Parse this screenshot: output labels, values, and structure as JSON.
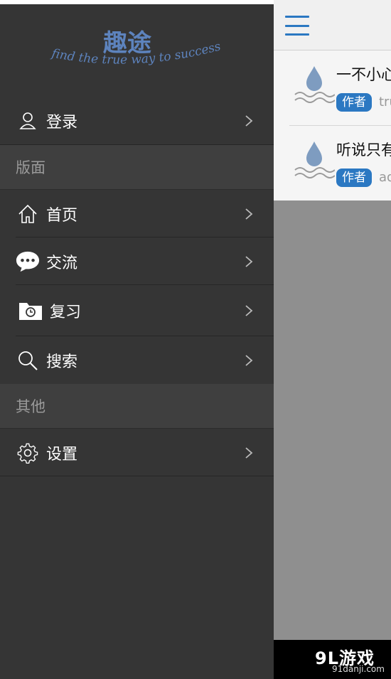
{
  "drawer": {
    "logo": {
      "title": "趣途",
      "slogan": "find the true way to success"
    },
    "login_label": "登录",
    "sections": [
      {
        "title": "版面",
        "items": [
          {
            "label": "首页",
            "icon": "home-icon"
          },
          {
            "label": "交流",
            "icon": "chat-bubble-icon"
          },
          {
            "label": "复习",
            "icon": "folder-history-icon"
          },
          {
            "label": "搜索",
            "icon": "search-icon"
          }
        ]
      },
      {
        "title": "其他",
        "items": [
          {
            "label": "设置",
            "icon": "gear-icon"
          }
        ]
      }
    ]
  },
  "main": {
    "posts": [
      {
        "title": "一不小心",
        "badge": "作者",
        "author": "tru"
      },
      {
        "title": "听说只有",
        "badge": "作者",
        "author": "ad"
      }
    ]
  },
  "watermark": {
    "brand": "9L游戏",
    "site": "91danji.com"
  },
  "colors": {
    "drawer_bg": "#353535",
    "section_bg": "#3f3f3f",
    "accent_blue": "#2b78c2",
    "dim_overlay": "#8f8f8f"
  }
}
